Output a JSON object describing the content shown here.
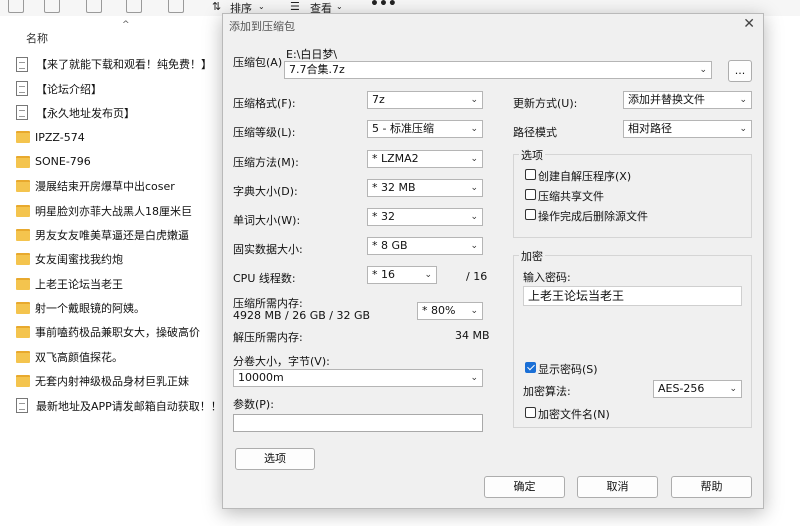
{
  "explorer": {
    "toolbar": {
      "sort_label": "排序",
      "view_label": "查看",
      "more_label": "•••"
    },
    "column_header": "名称",
    "files": [
      {
        "type": "doc",
        "name": "【来了就能下载和观看！纯免费！】"
      },
      {
        "type": "doc",
        "name": "【论坛介绍】"
      },
      {
        "type": "doc",
        "name": "【永久地址发布页】"
      },
      {
        "type": "folder",
        "name": "IPZZ-574"
      },
      {
        "type": "folder",
        "name": "SONE-796"
      },
      {
        "type": "folder",
        "name": "漫展结束开房爆草中出coser"
      },
      {
        "type": "folder",
        "name": "明星脸刘亦菲大战黑人18厘米巨"
      },
      {
        "type": "folder",
        "name": "男友女友唯美草逼还是白虎嫩逼"
      },
      {
        "type": "folder",
        "name": "女友闺蜜找我约炮"
      },
      {
        "type": "folder",
        "name": "上老王论坛当老王"
      },
      {
        "type": "folder",
        "name": "射一个戴眼镜的阿姨。"
      },
      {
        "type": "folder",
        "name": "事前嗑药极品兼职女大，操破高价"
      },
      {
        "type": "folder",
        "name": "双飞高颜值探花。"
      },
      {
        "type": "folder",
        "name": "无套内射神级极品身材巨乳正妹"
      },
      {
        "type": "doc",
        "name": "最新地址及APP请发邮箱自动获取！！！"
      }
    ]
  },
  "dialog": {
    "title": "添加到压缩包",
    "close_symbol": "✕",
    "archive_label": "压缩包(A)",
    "archive_path": "E:\\白日梦\\",
    "archive_name": "7.7合集.7z",
    "browse_label": "...",
    "format_label": "压缩格式(F):",
    "format_value": "7z",
    "level_label": "压缩等级(L):",
    "level_value": "5 - 标准压缩",
    "method_label": "压缩方法(M):",
    "method_value": "* LZMA2",
    "dict_label": "字典大小(D):",
    "dict_value": "* 32 MB",
    "word_label": "单词大小(W):",
    "word_value": "* 32",
    "solid_label": "固实数据大小:",
    "solid_value": "* 8 GB",
    "threads_label": "CPU 线程数:",
    "threads_value": "* 16",
    "threads_max": "/ 16",
    "mem_comp_label": "压缩所需内存:",
    "mem_comp_detail": "4928 MB / 26 GB / 32 GB",
    "mem_percent_value": "* 80%",
    "mem_decomp_label": "解压所需内存:",
    "mem_decomp_value": "34 MB",
    "split_label": "分卷大小，字节(V):",
    "split_value": "10000m",
    "params_label": "参数(P):",
    "params_value": "",
    "options_button": "选项",
    "update_label": "更新方式(U):",
    "update_value": "添加并替换文件",
    "path_label": "路径模式",
    "path_value": "相对路径",
    "options_group": {
      "title": "选项",
      "items": [
        {
          "label": "创建自解压程序(X)",
          "checked": false
        },
        {
          "label": "压缩共享文件",
          "checked": false
        },
        {
          "label": "操作完成后删除源文件",
          "checked": false
        }
      ]
    },
    "encrypt_group": {
      "title": "加密",
      "password_label": "输入密码:",
      "password_value": "上老王论坛当老王",
      "show_password_label": "显示密码(S)",
      "show_password_checked": true,
      "algo_label": "加密算法:",
      "algo_value": "AES-256",
      "encrypt_names_label": "加密文件名(N)",
      "encrypt_names_checked": false
    },
    "ok_label": "确定",
    "cancel_label": "取消",
    "help_label": "帮助"
  }
}
